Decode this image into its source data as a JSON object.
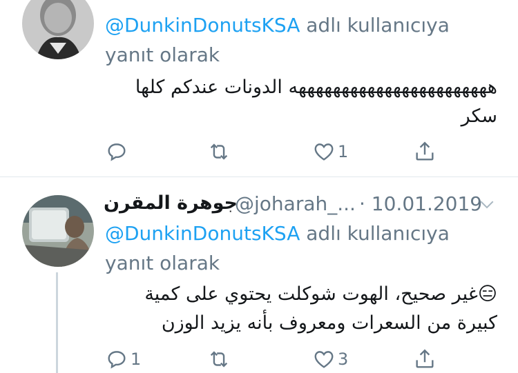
{
  "tweets": [
    {
      "avatar": "avatar-bw-portrait",
      "reply_to": {
        "mention": "@DunkinDonutsKSA",
        "suffix": " adlı kullanıcıya yanıt olarak"
      },
      "text": "هههههههههههههههههههههههه الدونات عندكم كلها سكر",
      "actions": {
        "reply_count": "",
        "retweet_count": "",
        "like_count": "1"
      }
    },
    {
      "avatar": "avatar-car-window",
      "name": "جوهرة المقرن",
      "handle": "@joharah_...",
      "date": "· 10.01.2019",
      "reply_to": {
        "mention": "@DunkinDonutsKSA",
        "suffix": " adlı kullanıcıya yanıt olarak"
      },
      "text": "😑غير صحيح، الهوت شوكلت يحتوي على كمية كبيرة من السعرات ومعروف بأنه يزيد الوزن",
      "actions": {
        "reply_count": "1",
        "retweet_count": "",
        "like_count": "3"
      }
    }
  ],
  "colors": {
    "accent": "#1da1f2",
    "muted": "#657786",
    "text": "#14171a",
    "divider": "#e1e8ed"
  }
}
